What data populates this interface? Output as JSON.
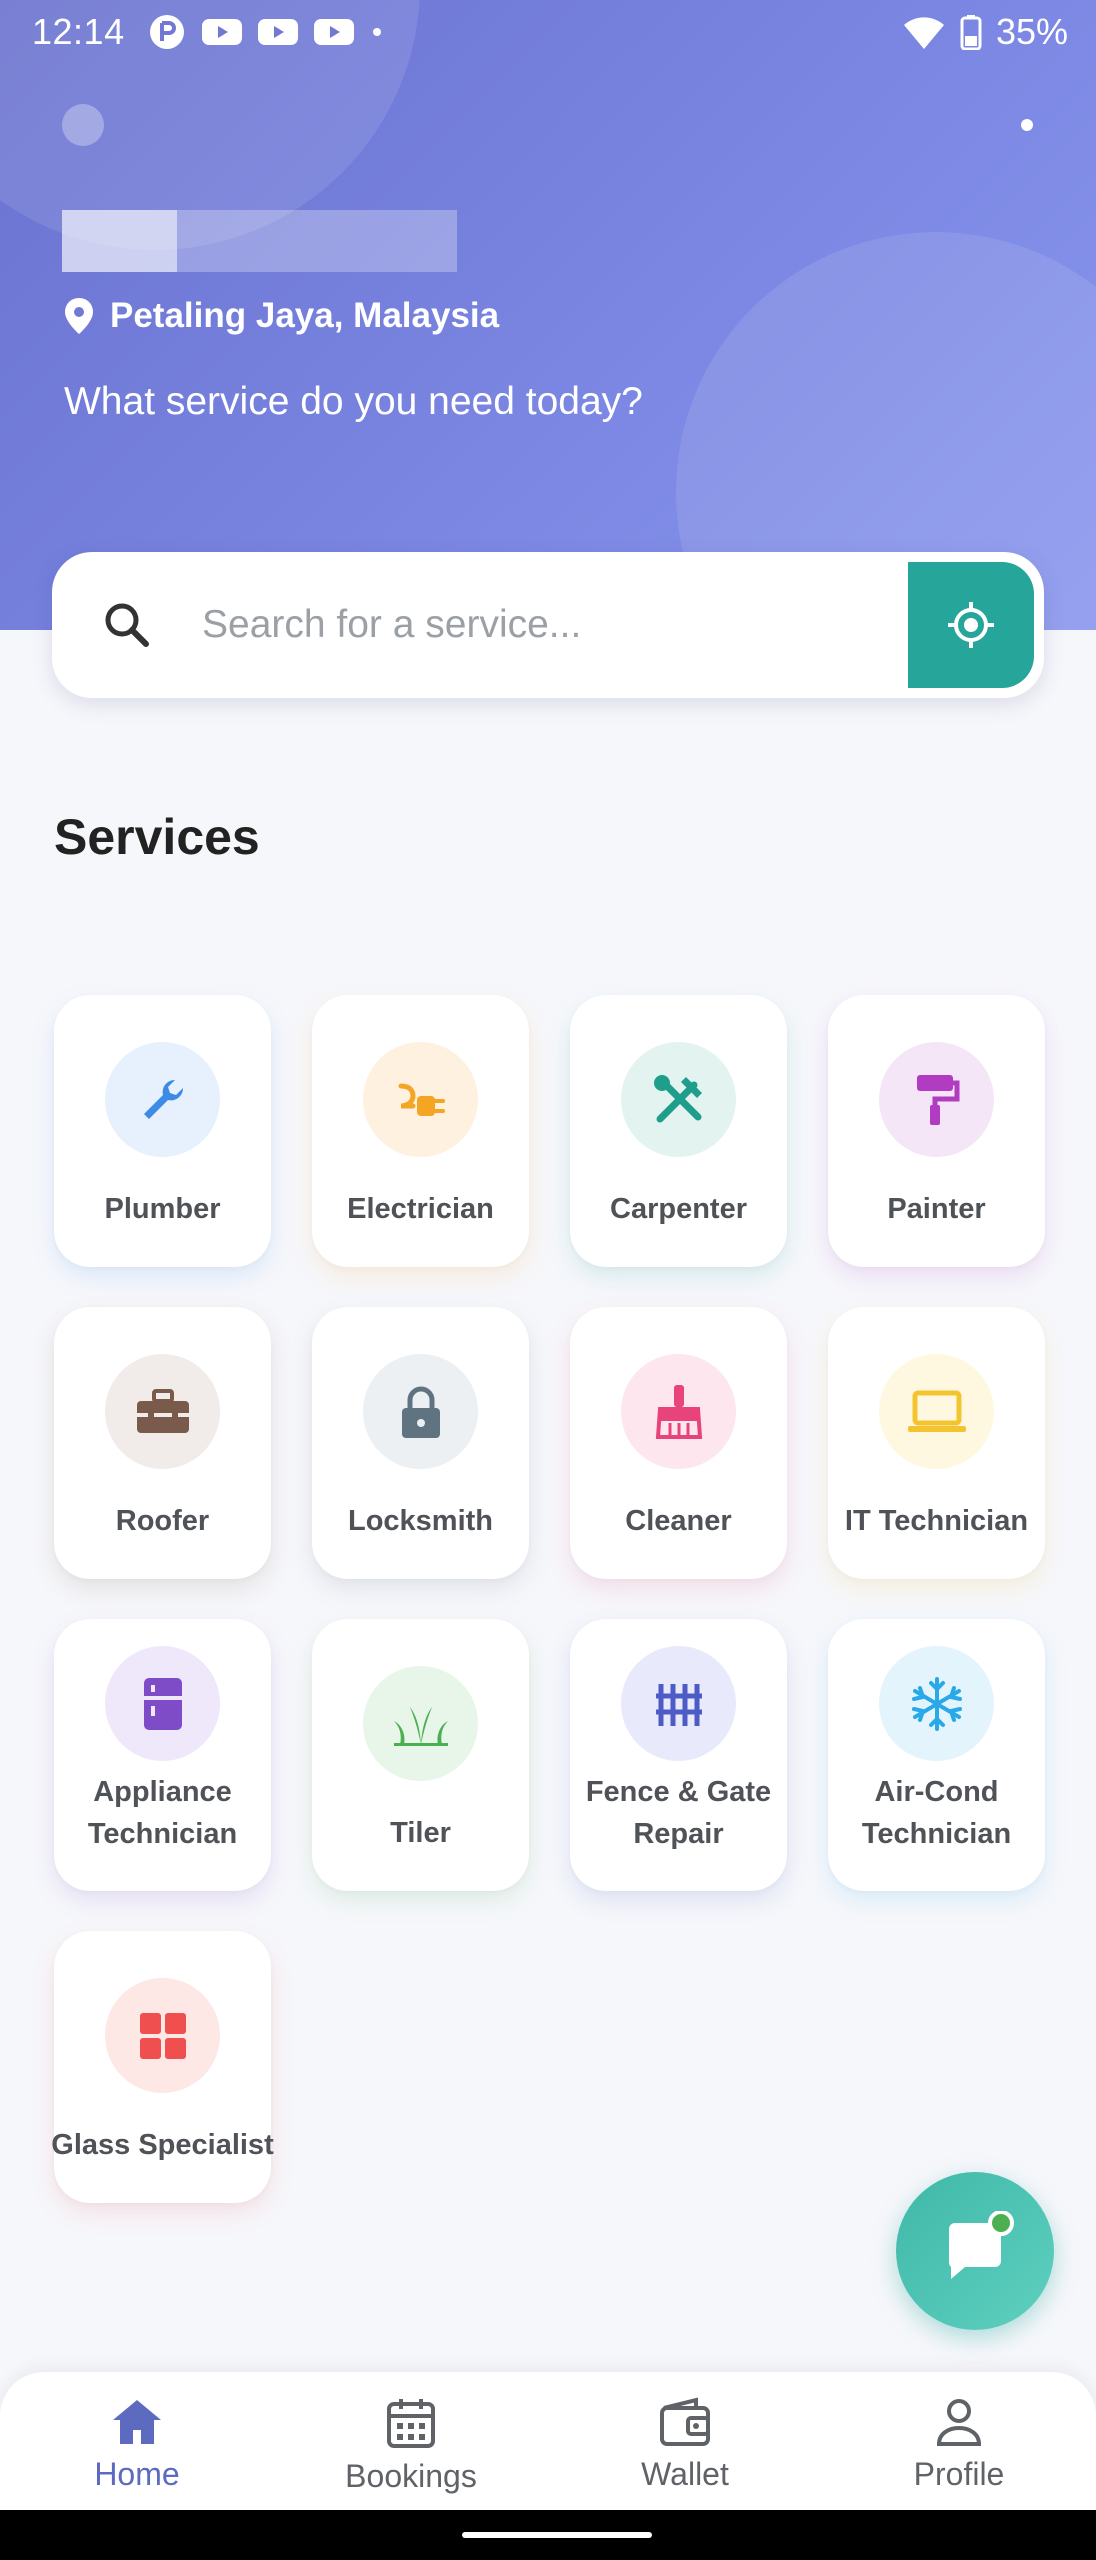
{
  "status_bar": {
    "time": "12:14",
    "battery": "35%"
  },
  "header": {
    "location": "Petaling Jaya, Malaysia",
    "question": "What service do you need today?"
  },
  "search": {
    "placeholder": "Search for a service..."
  },
  "services_title": "Services",
  "services": [
    {
      "label": "Plumber",
      "icon": "wrench-icon",
      "color": "#3d8be6",
      "bg": "#e6f1fd"
    },
    {
      "label": "Electrician",
      "icon": "plug-icon",
      "color": "#f5a524",
      "bg": "#fff1e0"
    },
    {
      "label": "Carpenter",
      "icon": "hammer-wrench-icon",
      "color": "#1f9e8b",
      "bg": "#e3f3f0"
    },
    {
      "label": "Painter",
      "icon": "paint-roller-icon",
      "color": "#b23cc1",
      "bg": "#f4e6f7"
    },
    {
      "label": "Roofer",
      "icon": "toolbox-icon",
      "color": "#7a5a4b",
      "bg": "#f1ecea"
    },
    {
      "label": "Locksmith",
      "icon": "lock-icon",
      "color": "#5f7380",
      "bg": "#ecf0f2"
    },
    {
      "label": "Cleaner",
      "icon": "broom-icon",
      "color": "#e8437a",
      "bg": "#fde6ee"
    },
    {
      "label": "IT Technician",
      "icon": "laptop-icon",
      "color": "#f4c430",
      "bg": "#fff8e1"
    },
    {
      "label": "Appliance Technician",
      "icon": "fridge-icon",
      "color": "#7d4cc6",
      "bg": "#efe8fa"
    },
    {
      "label": "Tiler",
      "icon": "grass-icon",
      "color": "#4caf50",
      "bg": "#e8f5e9"
    },
    {
      "label": "Fence & Gate Repair",
      "icon": "fence-icon",
      "color": "#4c5bc5",
      "bg": "#e8eafb"
    },
    {
      "label": "Air-Cond Technician",
      "icon": "snowflake-icon",
      "color": "#29a9e8",
      "bg": "#e3f4fd"
    },
    {
      "label": "Glass Specialist",
      "icon": "window-icon",
      "color": "#ef4f4f",
      "bg": "#fde8e6"
    }
  ],
  "nav": [
    {
      "label": "Home",
      "icon": "home-icon",
      "active": true
    },
    {
      "label": "Bookings",
      "icon": "calendar-icon",
      "active": false
    },
    {
      "label": "Wallet",
      "icon": "wallet-icon",
      "active": false
    },
    {
      "label": "Profile",
      "icon": "person-icon",
      "active": false
    }
  ],
  "colors": {
    "accent": "#5c6bc0",
    "teal": "#26a69a",
    "header_start": "#6a72cf",
    "header_end": "#8a97ee"
  }
}
